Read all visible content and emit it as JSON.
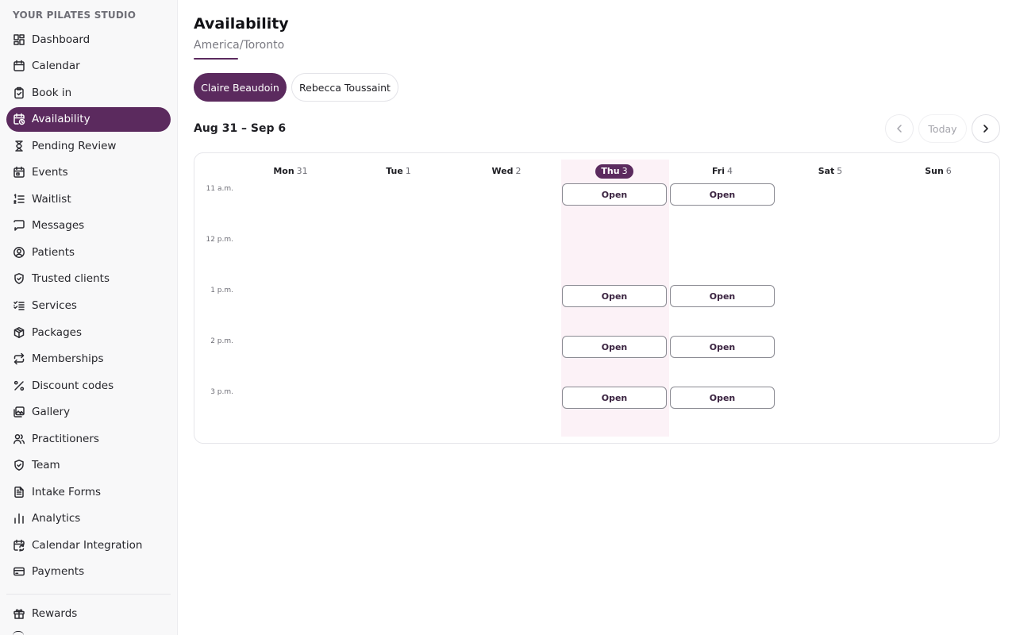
{
  "sidebar": {
    "brand": "YOUR PILATES STUDIO",
    "items": [
      {
        "label": "Dashboard",
        "icon": "dashboard-icon"
      },
      {
        "label": "Calendar",
        "icon": "calendar-icon"
      },
      {
        "label": "Book in",
        "icon": "clipboard-icon"
      },
      {
        "label": "Availability",
        "icon": "calendar-clock-icon",
        "active": true
      },
      {
        "label": "Pending Review",
        "icon": "hourglass-icon"
      },
      {
        "label": "Events",
        "icon": "calendar-event-icon"
      },
      {
        "label": "Waitlist",
        "icon": "list-ordered-icon"
      },
      {
        "label": "Messages",
        "icon": "message-icon"
      },
      {
        "label": "Patients",
        "icon": "user-circle-icon"
      },
      {
        "label": "Trusted clients",
        "icon": "shield-check-icon"
      },
      {
        "label": "Services",
        "icon": "list-checks-icon"
      },
      {
        "label": "Packages",
        "icon": "package-icon"
      },
      {
        "label": "Memberships",
        "icon": "repeat-icon"
      },
      {
        "label": "Discount codes",
        "icon": "percent-icon"
      },
      {
        "label": "Gallery",
        "icon": "images-icon"
      },
      {
        "label": "Practitioners",
        "icon": "users-icon"
      },
      {
        "label": "Team",
        "icon": "shield-check-icon"
      },
      {
        "label": "Intake Forms",
        "icon": "file-text-icon"
      },
      {
        "label": "Analytics",
        "icon": "bar-chart-icon"
      },
      {
        "label": "Calendar Integration",
        "icon": "calendar-sync-icon"
      },
      {
        "label": "Payments",
        "icon": "credit-card-icon"
      }
    ],
    "bottom_items": [
      {
        "label": "Rewards",
        "icon": "gift-icon"
      }
    ]
  },
  "header": {
    "title": "Availability",
    "timezone": "America/Toronto"
  },
  "practitioners": [
    "Claire Beaudoin",
    "Rebecca Toussaint"
  ],
  "selected_practitioner": "Claire Beaudoin",
  "week": {
    "range": "Aug 31 – Sep 6",
    "today_label": "Today",
    "days": [
      {
        "name": "Mon",
        "date": "31"
      },
      {
        "name": "Tue",
        "date": "1"
      },
      {
        "name": "Wed",
        "date": "2"
      },
      {
        "name": "Thu",
        "date": "3",
        "today": true
      },
      {
        "name": "Fri",
        "date": "4"
      },
      {
        "name": "Sat",
        "date": "5"
      },
      {
        "name": "Sun",
        "date": "6"
      }
    ],
    "times": [
      "11 a.m.",
      "12 p.m.",
      "1 p.m.",
      "2 p.m.",
      "3 p.m."
    ],
    "slot_label": "Open",
    "slots": [
      {
        "day": "Thu",
        "time": "11 a.m."
      },
      {
        "day": "Fri",
        "time": "11 a.m."
      },
      {
        "day": "Thu",
        "time": "1 p.m."
      },
      {
        "day": "Fri",
        "time": "1 p.m."
      },
      {
        "day": "Thu",
        "time": "2 p.m."
      },
      {
        "day": "Fri",
        "time": "2 p.m."
      },
      {
        "day": "Thu",
        "time": "3 p.m."
      },
      {
        "day": "Fri",
        "time": "3 p.m."
      }
    ]
  },
  "colors": {
    "accent": "#5b2a5e",
    "today_column": "#fcf2f7"
  }
}
